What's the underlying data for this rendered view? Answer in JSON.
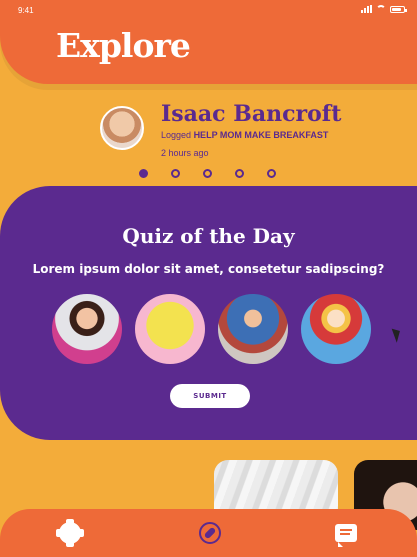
{
  "status_bar": {
    "time": "9:41"
  },
  "header": {
    "title": "Explore"
  },
  "activity": {
    "user_name": "Isaac Bancroft",
    "action_prefix": "Logged",
    "action_text": "HELP MOM MAKE BREAKFAST",
    "time_ago": "2 hours ago",
    "pager": {
      "total": 5,
      "active_index": 0
    }
  },
  "quiz": {
    "title": "Quiz of the Day",
    "question": "Lorem ipsum dolor sit amet, consetetur sadipscing?",
    "submit_label": "SUBMIT"
  },
  "nav": {
    "items": [
      "settings-icon",
      "explore-compass-icon",
      "chat-icon"
    ],
    "active": "explore-compass-icon"
  },
  "colors": {
    "orange": "#EE6A38",
    "yellow": "#F3AC3A",
    "purple": "#5B2A8F",
    "white": "#FFFFFF"
  }
}
